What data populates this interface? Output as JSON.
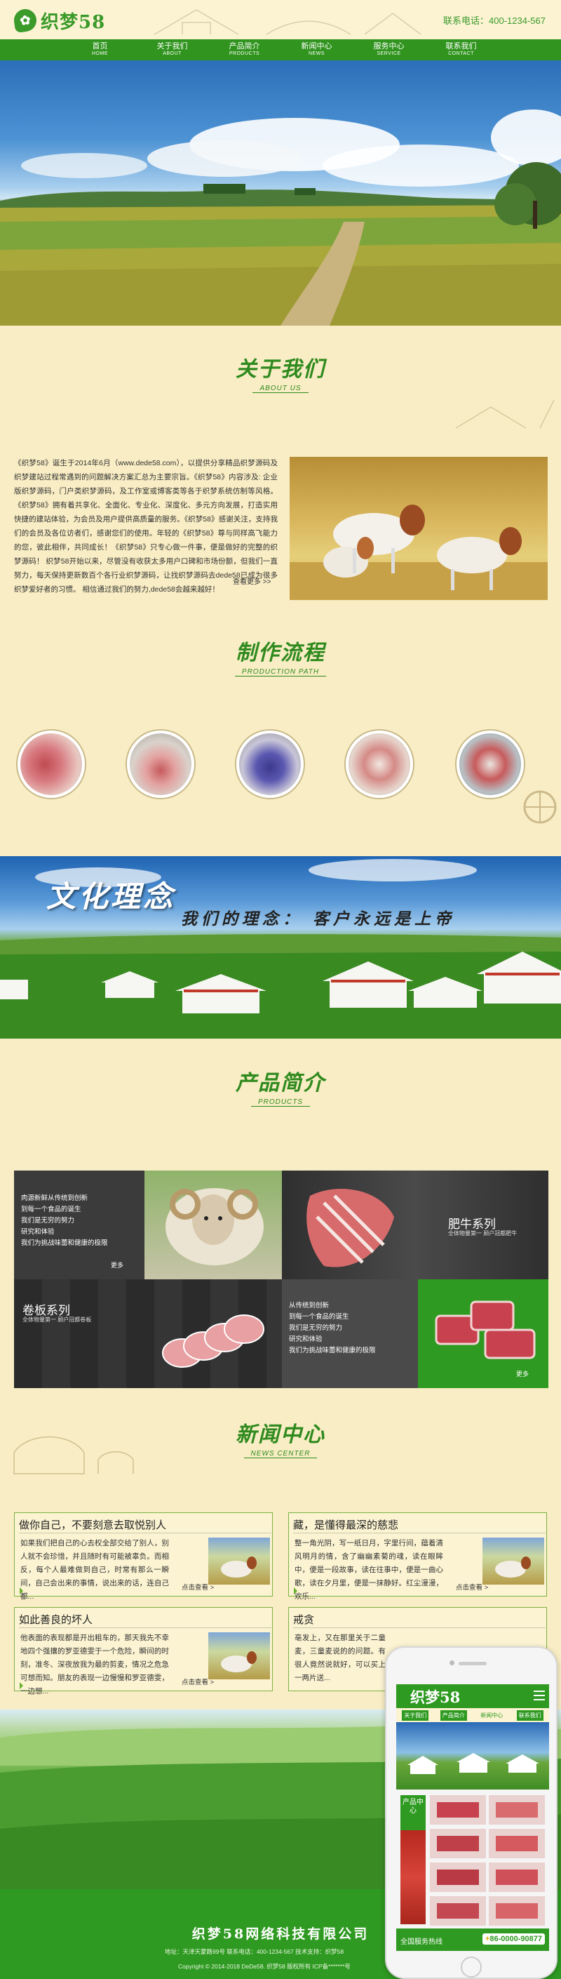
{
  "header": {
    "logo_text": "织梦58",
    "phone": "联系电话：400-1234-567"
  },
  "nav": [
    {
      "cn": "首页",
      "en": "HOME"
    },
    {
      "cn": "关于我们",
      "en": "ABOUT"
    },
    {
      "cn": "产品简介",
      "en": "PRODUCTS"
    },
    {
      "cn": "新闻中心",
      "en": "NEWS"
    },
    {
      "cn": "服务中心",
      "en": "SERVICE"
    },
    {
      "cn": "联系我们",
      "en": "CONTACT"
    }
  ],
  "about": {
    "title_cn": "关于我们",
    "title_en": "ABOUT US",
    "text": "《织梦58》诞生于2014年6月（www.dede58.com），以提供分享精品织梦源码及织梦建站过程常遇到的问题解决方案汇总为主要宗旨。《织梦58》内容涉及: 企业版织梦源码，门户类织梦源码，及工作室或博客类等各于织梦系统仿制等风格。《织梦58》拥有着共享化、全面化、专业化、深度化、多元方向发展，打造实用快捷的建站体验，为会员及用户提供高质量的服务。《织梦58》感谢关注，支持我们的会员及各位访者们，感谢您们的使用。年轻的《织梦58》尊与同样高飞能力的您，彼此相伴，共同成长！《织梦58》只专心做一件事，便是做好的完整的织梦源码！ 织梦58开始以来，尽管没有收获太多用户口碑和市场份额，但我们一直努力，每天保持更新数百个各行业织梦源码，让找织梦源码去dede58已成为很多织梦爱好者的习惯。 相信通过我们的努力,dede58会越来越好！",
    "more": "查看更多 >>"
  },
  "process": {
    "title_cn": "制作流程",
    "title_en": "PRODUCTION PATH"
  },
  "culture": {
    "title": "文化理念",
    "slogan": "我们的理念：  客户永远是上帝"
  },
  "products": {
    "title_cn": "产品简介",
    "title_en": "PRODUCTS",
    "text_lines": [
      "肉源新鲜从传统到创新",
      "到每一个食品的诞生",
      "我们是无穷的努力",
      "研究和体验",
      "我们为挑战味蕾和健康的极限"
    ],
    "text_lines2": [
      "从传统到创新",
      "到每一个食品的诞生",
      "我们是无穷的努力",
      "研究和体验",
      "我们为挑战味蕾和健康的极限"
    ],
    "more": "更多",
    "series1_name": "肥牛系列",
    "series1_sub": "全体物量第一 顾户冠都肥牛",
    "series2_name": "卷板系列",
    "series2_sub": "全体物量第一 顾户冠都卷板"
  },
  "news": {
    "title_cn": "新闻中心",
    "title_en": "NEWS CENTER",
    "more": "点击查看 >",
    "items": [
      {
        "title": "做你自己，不要刻意去取悦别人",
        "body": "如果我们把自己的心去权全部交给了别人，别人就不会珍惜，并且随时有可能被辜负。而相反，每个人最难做到自己，时常有那么一瞬间，自己会出来的事情，说出来的话，连自己都..."
      },
      {
        "title": "藏，是懂得最深的慈悲",
        "body": "整一角光阴，写一纸日月，字里行间，蕴着清风明月的情，含了幽幽素菊的魂，读在眼眸中，便是一段故事，读在往事中，便是一曲心歌，读在夕月里，便是一抹静好。红尘漫漫，欢乐..."
      },
      {
        "title": "如此善良的坏人",
        "body": "他表面的表现都是开出粗车的，那天我先不幸地四个强攘的罗亚德雯于一个危险，瞬间的时刻，准冬、深夜放我为最的剪麦，情况之危急可想而知。朋友的表现一边慢慢和罗亚德雯，一边想..."
      },
      {
        "title": "戒贪",
        "body": "亳发上，又在那里关于二童麦，三童麦说的的问题。有很人竟然说就好，可以买上一两片送..."
      }
    ]
  },
  "footer": {
    "company": "织梦58网络科技有限公司",
    "line1": "地址：天津天蒙路99号   联系电话：400-1234-567   技术支持：织梦58",
    "line2": "Copyright © 2014-2018 DeDe58. 织梦58 版权所有   ICP备*******号"
  },
  "mobile": {
    "logo": "织梦58",
    "nav": [
      "关于我们",
      "产品简介",
      "新闻中心",
      "联系我们"
    ],
    "product_tag": "产品中心",
    "hotline_label": "全国服务热线",
    "hotline_prefix": "+",
    "hotline_number": "86-0000-90877"
  }
}
